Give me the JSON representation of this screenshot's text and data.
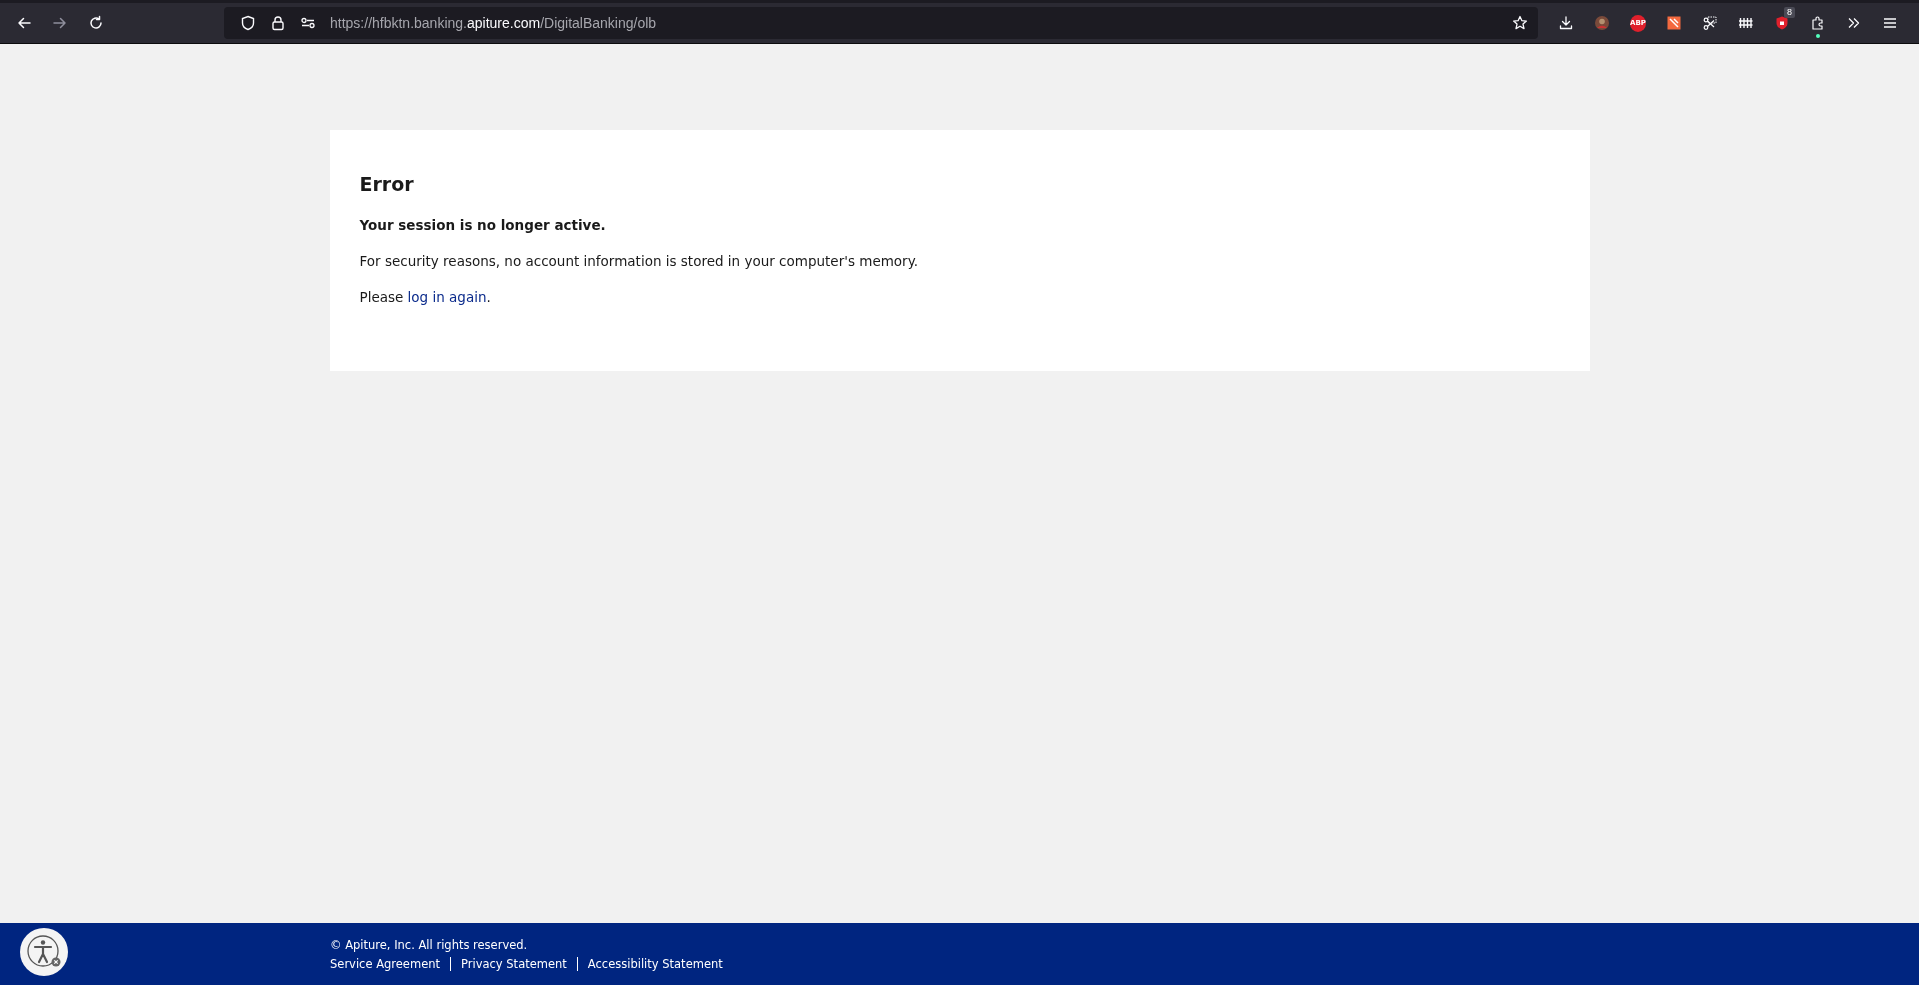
{
  "browser": {
    "nav_buttons": [
      {
        "kind": "back",
        "disabled": false
      },
      {
        "kind": "forward",
        "disabled": true
      },
      {
        "kind": "reload",
        "disabled": false
      }
    ],
    "url": {
      "prefix": "https://hfbktn.banking.",
      "domain": "apiture.com",
      "suffix": "/DigitalBanking/olb"
    },
    "toolbar_icons": [
      {
        "kind": "download"
      },
      {
        "kind": "avatar"
      },
      {
        "kind": "abp",
        "label": "ABP"
      },
      {
        "kind": "orange"
      },
      {
        "kind": "scissors"
      },
      {
        "kind": "fence"
      },
      {
        "kind": "shield",
        "badge": "8"
      },
      {
        "kind": "puzzle"
      },
      {
        "kind": "overflow"
      },
      {
        "kind": "menu"
      }
    ]
  },
  "error_card": {
    "title": "Error",
    "subtitle": "Your session is no longer active.",
    "message": "For security reasons, no account information is stored in your computer's memory.",
    "prompt": "Please ",
    "link": "log in again",
    "after_link": "."
  },
  "footer": {
    "copyright": "© Apiture, Inc. All rights reserved.",
    "links": [
      "Service Agreement",
      "Privacy Statement",
      "Accessibility Statement"
    ]
  }
}
